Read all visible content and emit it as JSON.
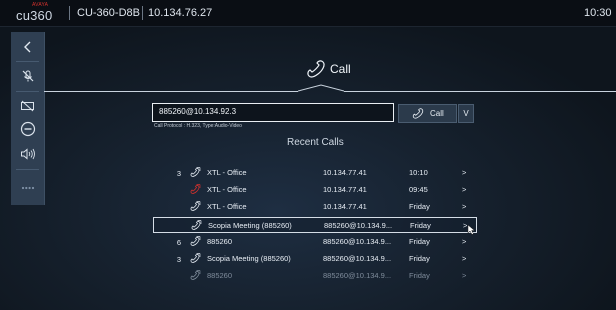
{
  "topbar": {
    "brand_small": "AVAYA",
    "brand": "cu360",
    "device": "CU-360-D8B",
    "ip": "10.134.76.27",
    "clock": "10:30"
  },
  "sidebar": {
    "items": [
      {
        "icon": "back-arrow-icon"
      },
      {
        "icon": "mic-muted-icon"
      },
      {
        "icon": "camera-off-icon"
      },
      {
        "icon": "volume-down-icon"
      },
      {
        "icon": "volume-up-icon"
      },
      {
        "icon": "more-icon"
      }
    ]
  },
  "call": {
    "title": "Call",
    "dial_value": "885260@10.134.92.3",
    "call_button": "Call",
    "dropdown": "V",
    "protocol": "Call Protocol : H.323,  Type:Audio-Video"
  },
  "recent": {
    "heading": "Recent Calls",
    "rows": [
      {
        "count": "3",
        "name": "XTL - Office",
        "address": "10.134.77.41",
        "time": "10:10",
        "go": ">",
        "status": "normal"
      },
      {
        "count": "",
        "name": "XTL - Office",
        "address": "10.134.77.41",
        "time": "09:45",
        "go": ">",
        "status": "missed"
      },
      {
        "count": "",
        "name": "XTL - Office",
        "address": "10.134.77.41",
        "time": "Friday",
        "go": ">",
        "status": "normal"
      },
      {
        "count": "",
        "name": "Scopia Meeting (885260)",
        "address": "885260@10.134.9...",
        "time": "Friday",
        "go": ">",
        "status": "selected"
      },
      {
        "count": "6",
        "name": "885260",
        "address": "885260@10.134.9...",
        "time": "Friday",
        "go": ">",
        "status": "normal"
      },
      {
        "count": "3",
        "name": "Scopia Meeting (885260)",
        "address": "885260@10.134.9...",
        "time": "Friday",
        "go": ">",
        "status": "normal"
      },
      {
        "count": "",
        "name": "885260",
        "address": "885260@10.134.9...",
        "time": "Friday",
        "go": ">",
        "status": "dim"
      }
    ]
  },
  "colors": {
    "background": "#0d1219",
    "sidebar": "#2f3f52",
    "missed": "#d0312d",
    "text": "#e6edf5"
  }
}
